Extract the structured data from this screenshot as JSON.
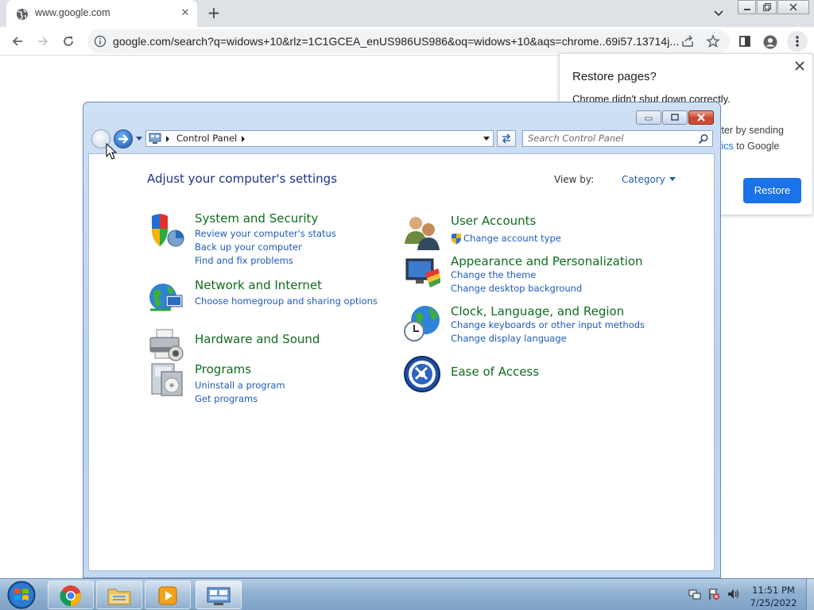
{
  "browser": {
    "tab_title": "www.google.com",
    "tab_close": "✕",
    "new_tab": "+",
    "url": "google.com/search?q=widows+10&rlz=1C1GCEA_enUS986US986&oq=widows+10&aqs=chrome..69i57.13714j..."
  },
  "restore_bubble": {
    "title": "Restore pages?",
    "message": "Chrome didn't shut down correctly.",
    "frag1": "tter by sending",
    "frag2_link": "tics",
    "frag2_rest": " to Google",
    "button": "Restore"
  },
  "control_panel": {
    "breadcrumb": "Control Panel",
    "search_placeholder": "Search Control Panel",
    "heading": "Adjust your computer's settings",
    "view_by_label": "View by:",
    "view_by_value": "Category",
    "categories": [
      {
        "title": "System and Security",
        "links": [
          "Review your computer's status",
          "Back up your computer",
          "Find and fix problems"
        ]
      },
      {
        "title": "Network and Internet",
        "links": [
          "Choose homegroup and sharing options"
        ]
      },
      {
        "title": "Hardware and Sound",
        "links": []
      },
      {
        "title": "Programs",
        "links": [
          "Uninstall a program",
          "Get programs"
        ]
      },
      {
        "title": "User Accounts",
        "links": [
          "Change account type"
        ]
      },
      {
        "title": "Appearance and Personalization",
        "links": [
          "Change the theme",
          "Change desktop background"
        ]
      },
      {
        "title": "Clock, Language, and Region",
        "links": [
          "Change keyboards or other input methods",
          "Change display language"
        ]
      },
      {
        "title": "Ease of Access",
        "links": []
      }
    ]
  },
  "taskbar": {
    "time": "11:51 PM",
    "date": "7/25/2022",
    "items": [
      "chrome",
      "windows-explorer",
      "media-player",
      "control-panel"
    ]
  }
}
